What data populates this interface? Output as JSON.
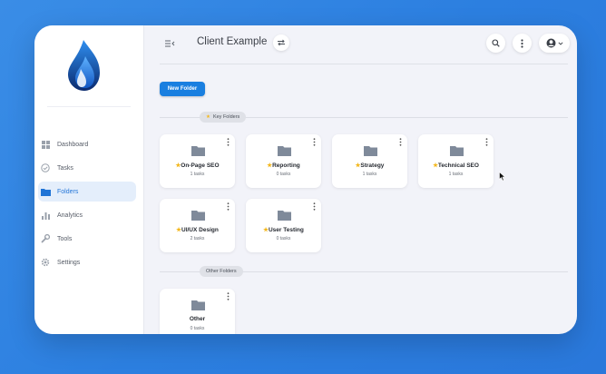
{
  "header": {
    "title": "Client Example"
  },
  "sidebar": {
    "items": [
      {
        "label": "Dashboard",
        "icon": "dashboard-icon"
      },
      {
        "label": "Tasks",
        "icon": "check-circle-icon"
      },
      {
        "label": "Folders",
        "icon": "folder-icon",
        "active": true
      },
      {
        "label": "Analytics",
        "icon": "bar-chart-icon"
      },
      {
        "label": "Tools",
        "icon": "wrench-icon"
      },
      {
        "label": "Settings",
        "icon": "gear-icon"
      }
    ]
  },
  "toolbar": {
    "new_folder_label": "New Folder"
  },
  "sections": [
    {
      "label": "Key Folders",
      "folders": [
        {
          "name": "On-Page SEO",
          "count": "1 tasks"
        },
        {
          "name": "Reporting",
          "count": "0 tasks"
        },
        {
          "name": "Strategy",
          "count": "1 tasks"
        },
        {
          "name": "Technical SEO",
          "count": "1 tasks"
        },
        {
          "name": "UI/UX Design",
          "count": "2 tasks"
        },
        {
          "name": "User Testing",
          "count": "0 tasks"
        }
      ]
    },
    {
      "label": "Other Folders",
      "folders": [
        {
          "name": "Other",
          "count": "0 tasks"
        }
      ]
    }
  ],
  "colors": {
    "accent": "#1a7fe0",
    "star": "#f3b71c",
    "folder": "#7f8a9a",
    "active_bg": "#e4eefb"
  }
}
